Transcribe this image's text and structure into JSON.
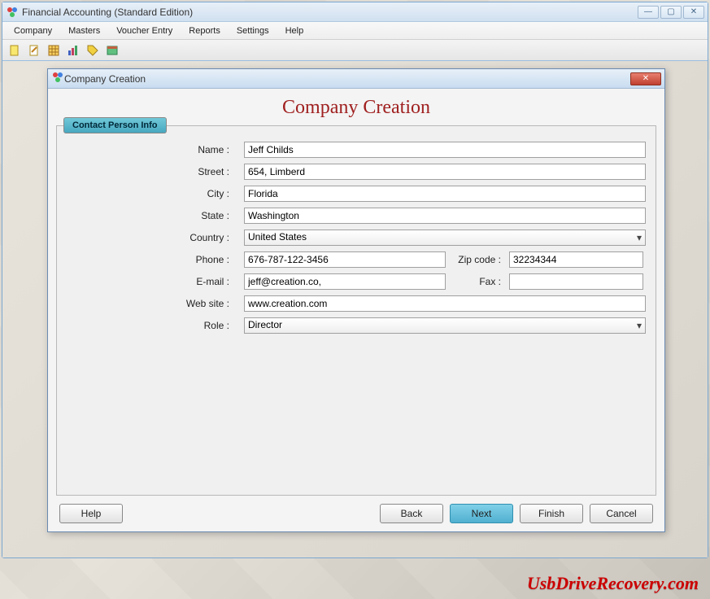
{
  "main_window": {
    "title": "Financial Accounting (Standard Edition)"
  },
  "menu": {
    "items": [
      "Company",
      "Masters",
      "Voucher Entry",
      "Reports",
      "Settings",
      "Help"
    ]
  },
  "toolbar": {
    "icons": [
      "new-doc-icon",
      "edit-icon",
      "grid-icon",
      "chart-icon",
      "tag-icon",
      "ledger-icon"
    ]
  },
  "dialog": {
    "title": "Company Creation",
    "heading": "Company Creation",
    "tab_label": "Contact Person Info",
    "fields": {
      "name_label": "Name :",
      "name_value": "Jeff Childs",
      "street_label": "Street :",
      "street_value": "654, Limberd",
      "city_label": "City :",
      "city_value": "Florida",
      "state_label": "State :",
      "state_value": "Washington",
      "country_label": "Country :",
      "country_value": "United States",
      "phone_label": "Phone :",
      "phone_value": "676-787-122-3456",
      "zip_label": "Zip code :",
      "zip_value": "32234344",
      "email_label": "E-mail :",
      "email_value": "jeff@creation.co,",
      "fax_label": "Fax :",
      "fax_value": "",
      "website_label": "Web site :",
      "website_value": "www.creation.com",
      "role_label": "Role :",
      "role_value": "Director"
    },
    "buttons": {
      "help": "Help",
      "back": "Back",
      "next": "Next",
      "finish": "Finish",
      "cancel": "Cancel"
    }
  },
  "watermark": "UsbDriveRecovery.com"
}
